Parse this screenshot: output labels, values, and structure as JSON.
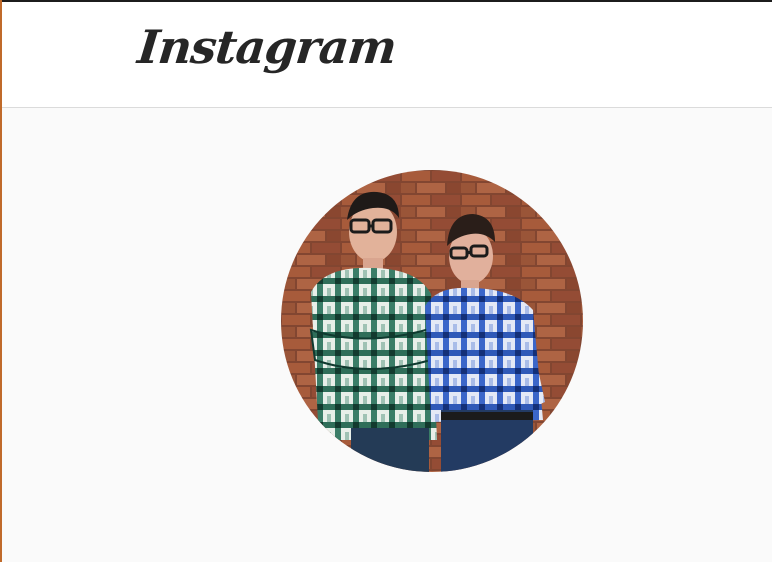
{
  "header": {
    "logo_text": "Instagram"
  },
  "profile": {
    "avatar_icon": "profile-photo-avatar"
  },
  "colors": {
    "background": "#fafafa",
    "header_background": "#ffffff",
    "header_border": "#dbdbdb",
    "logo": "#262626"
  }
}
